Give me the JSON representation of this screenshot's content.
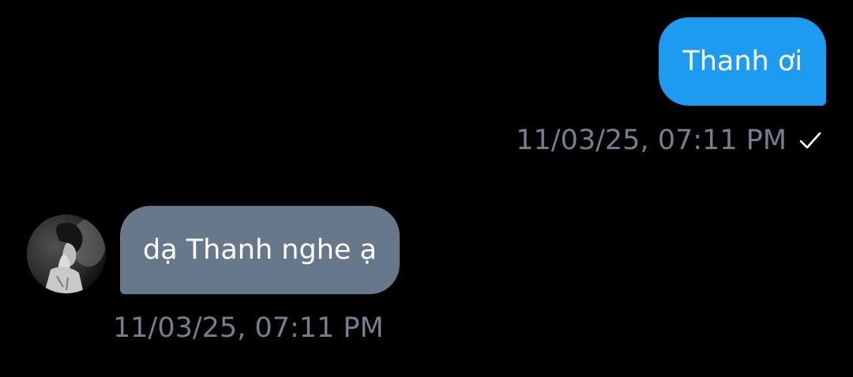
{
  "conversation": {
    "outgoing": {
      "text": "Thanh ơi",
      "timestamp": "11/03/25, 07:11 PM",
      "status_icon": "check-icon"
    },
    "incoming": {
      "avatar_icon": "avatar",
      "text": "dạ Thanh nghe ạ",
      "timestamp": "11/03/25, 07:11 PM"
    }
  },
  "colors": {
    "background": "#000000",
    "outgoing_bubble": "#1d9bf0",
    "incoming_bubble": "#66788a",
    "timestamp": "#71808e",
    "text": "#ffffff"
  }
}
